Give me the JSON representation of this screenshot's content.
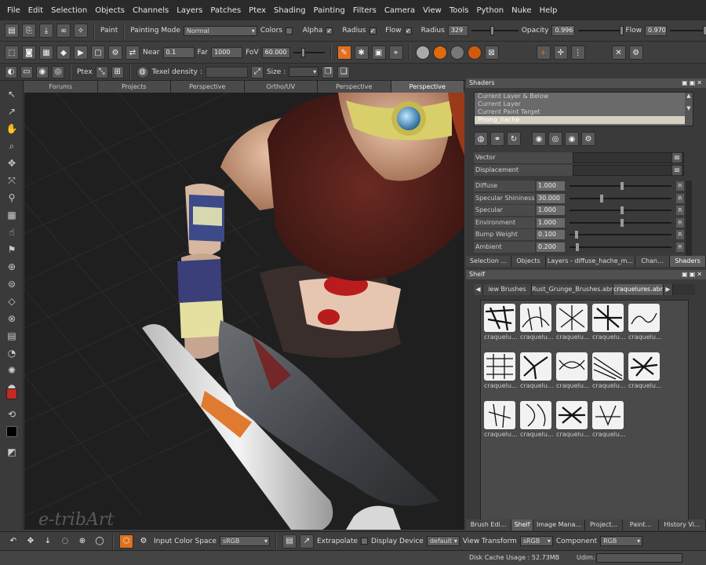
{
  "menu": [
    "File",
    "Edit",
    "Selection",
    "Objects",
    "Channels",
    "Layers",
    "Patches",
    "Ptex",
    "Shading",
    "Painting",
    "Filters",
    "Camera",
    "View",
    "Tools",
    "Python",
    "Nuke",
    "Help"
  ],
  "toolbar1": {
    "paint_label": "Paint",
    "painting_mode_label": "Painting Mode",
    "painting_mode_value": "Normal",
    "colors_label": "Colors",
    "alpha_label": "Alpha",
    "radius_chk_label": "Radius",
    "flow_chk_label": "Flow",
    "radius_label": "Radius",
    "radius_value": "329",
    "radius_level": 0.45,
    "opacity_label": "Opacity",
    "opacity_value": "0.996",
    "opacity_level": 0.996,
    "flow_label": "Flow",
    "flow_value": "0.970",
    "flow_level": 0.97
  },
  "toolbar2": {
    "near_label": "Near",
    "near_value": "0.1",
    "far_label": "Far",
    "far_value": "1000",
    "fov_label": "FoV",
    "fov_value": "60.000"
  },
  "toolbar3": {
    "ptex_label": "Ptex",
    "texel_label": "Texel density :",
    "size_label": "Size :"
  },
  "viewport_tabs": [
    "Forums",
    "Projects",
    "Perspective",
    "Ortho/UV",
    "Perspective",
    "Perspective"
  ],
  "viewport_active_tab": 5,
  "watermark": "e-tribArt",
  "shaders_panel": {
    "title": "Shaders",
    "list": [
      "Current Layer & Below",
      "Current Layer",
      "Current Paint Target",
      "Phong_hache"
    ],
    "selected": 3,
    "vector_label": "Vector",
    "displacement_label": "Displacement",
    "params": [
      {
        "label": "Diffuse",
        "value": "1.000",
        "level": 0.5
      },
      {
        "label": "Specular Shininess",
        "value": "30.000",
        "level": 0.3
      },
      {
        "label": "Specular",
        "value": "1.000",
        "level": 0.5
      },
      {
        "label": "Environment",
        "value": "1.000",
        "level": 0.5
      },
      {
        "label": "Bump Weight",
        "value": "0.100",
        "level": 0.05
      },
      {
        "label": "Ambient",
        "value": "0.200",
        "level": 0.06
      }
    ],
    "reset_label": "R",
    "tabs": [
      "Selection ...",
      "Objects",
      "Layers - diffuse_hache_m...",
      "Chan...",
      "Shaders"
    ],
    "active_tab": 4
  },
  "shelf_panel": {
    "title": "Shelf",
    "tabs": [
      "iew Brushes",
      "Rust_Grunge_Brushes.abr",
      "craquelures.abr"
    ],
    "active_tab": 2,
    "brush_label": "craquelu...",
    "brush_count": 14
  },
  "bottom_panel_tabs": [
    "Brush Edi...",
    "Shelf",
    "Image Mana...",
    "Project...",
    "Paint...",
    "History Vi..."
  ],
  "bottom_active_tab": 1,
  "bottombar": {
    "input_cs_label": "Input Color Space",
    "input_cs_value": "sRGB",
    "extrapolate_label": "Extrapolate",
    "display_device_label": "Display Device",
    "display_device_value": "default",
    "view_transform_label": "View Transform",
    "view_transform_value": "sRGB",
    "component_label": "Component",
    "component_value": "RGB"
  },
  "status": {
    "disk_cache": "Disk Cache Usage : 52.73MB",
    "udim": "Udim:"
  },
  "colors": {
    "accent": "#c42a22",
    "selected_row": "#d4cfc0",
    "orange_tool": "#e07020"
  }
}
